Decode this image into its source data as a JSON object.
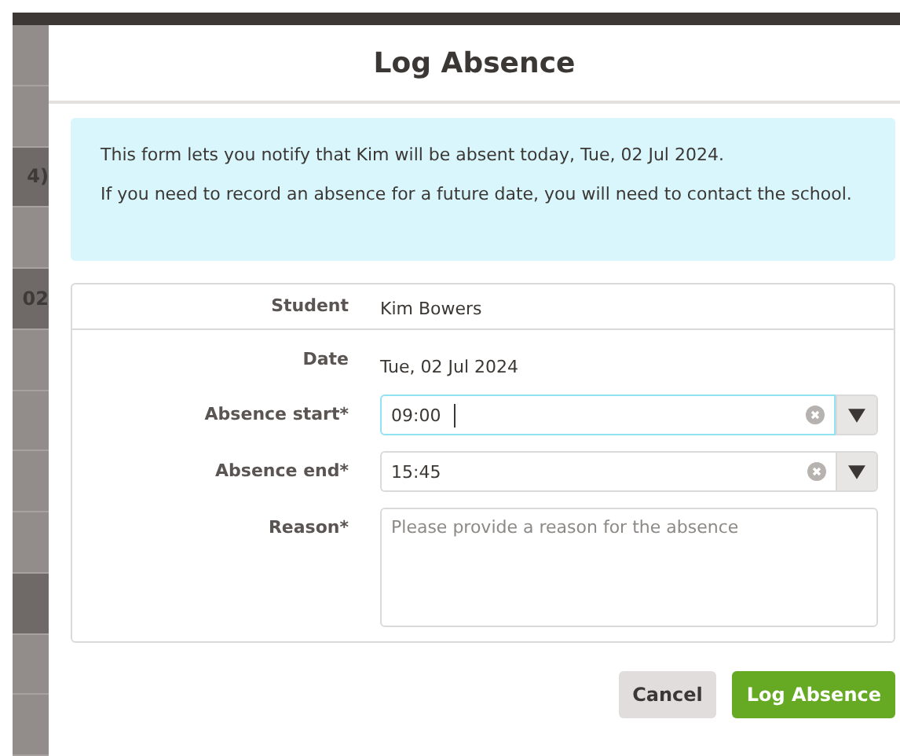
{
  "background_rows": [
    {
      "text": "",
      "shaded": false
    },
    {
      "text": "",
      "shaded": false
    },
    {
      "text": "4)",
      "shaded": true
    },
    {
      "text": "",
      "shaded": false
    },
    {
      "text": "02",
      "shaded": true
    },
    {
      "text": "",
      "shaded": false
    },
    {
      "text": "",
      "shaded": false
    },
    {
      "text": "",
      "shaded": false
    },
    {
      "text": "",
      "shaded": false
    },
    {
      "text": "",
      "shaded": true
    },
    {
      "text": "",
      "shaded": false
    },
    {
      "text": "",
      "shaded": false
    }
  ],
  "dialog": {
    "title": "Log Absence",
    "info": [
      "This form lets you notify that Kim will be absent today, Tue, 02 Jul 2024.",
      "If you need to record an absence for a future date, you will need to contact the school."
    ],
    "fields": [
      {
        "kind": "text",
        "label": "Student",
        "value": "Kim Bowers"
      },
      {
        "kind": "text",
        "label": "Date",
        "value": "Tue, 02 Jul 2024"
      },
      {
        "kind": "time",
        "label": "Absence start*",
        "value": "09:00",
        "focused": true
      },
      {
        "kind": "time",
        "label": "Absence end*",
        "value": "15:45",
        "focused": false
      },
      {
        "kind": "textarea",
        "label": "Reason*",
        "placeholder": "Please provide a reason for the absence"
      }
    ],
    "buttons": [
      {
        "label": "Cancel",
        "kind": "secondary"
      },
      {
        "label": "Log Absence",
        "kind": "primary"
      }
    ]
  }
}
